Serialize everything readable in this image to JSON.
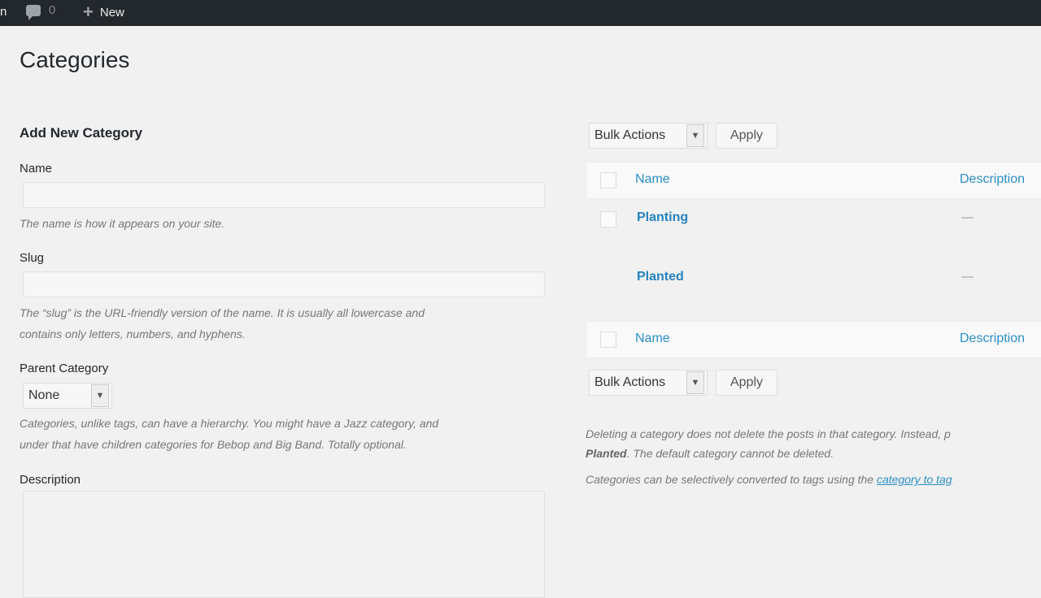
{
  "adminbar": {
    "edge_text": "n",
    "comments_count": "0",
    "new_label": "New"
  },
  "page": {
    "title": "Categories"
  },
  "form": {
    "title": "Add New Category",
    "name_label": "Name",
    "name_value": "",
    "name_help": "The name is how it appears on your site.",
    "slug_label": "Slug",
    "slug_value": "",
    "slug_help_line1": "The “slug” is the URL-friendly version of the name. It is usually all lowercase and",
    "slug_help_line2": "contains only letters, numbers, and hyphens.",
    "parent_label": "Parent Category",
    "parent_selected": "None",
    "parent_help_line1": "Categories, unlike tags, can have a hierarchy. You might have a Jazz category, and",
    "parent_help_line2": "under that have children categories for Bebop and Big Band. Totally optional.",
    "description_label": "Description"
  },
  "table": {
    "bulk_actions_label": "Bulk Actions",
    "apply_label": "Apply",
    "col_name": "Name",
    "col_description": "Description",
    "rows": [
      {
        "name": "Planting",
        "description": "—"
      },
      {
        "name": "Planted",
        "description": "—"
      }
    ]
  },
  "notes": {
    "delete_line1": "Deleting a category does not delete the posts in that category. Instead, p",
    "delete_bold": "Planted",
    "delete_line2_rest": ". The default category cannot be deleted.",
    "convert_text": "Categories can be selectively converted to tags using the ",
    "convert_link": "category to tag"
  }
}
